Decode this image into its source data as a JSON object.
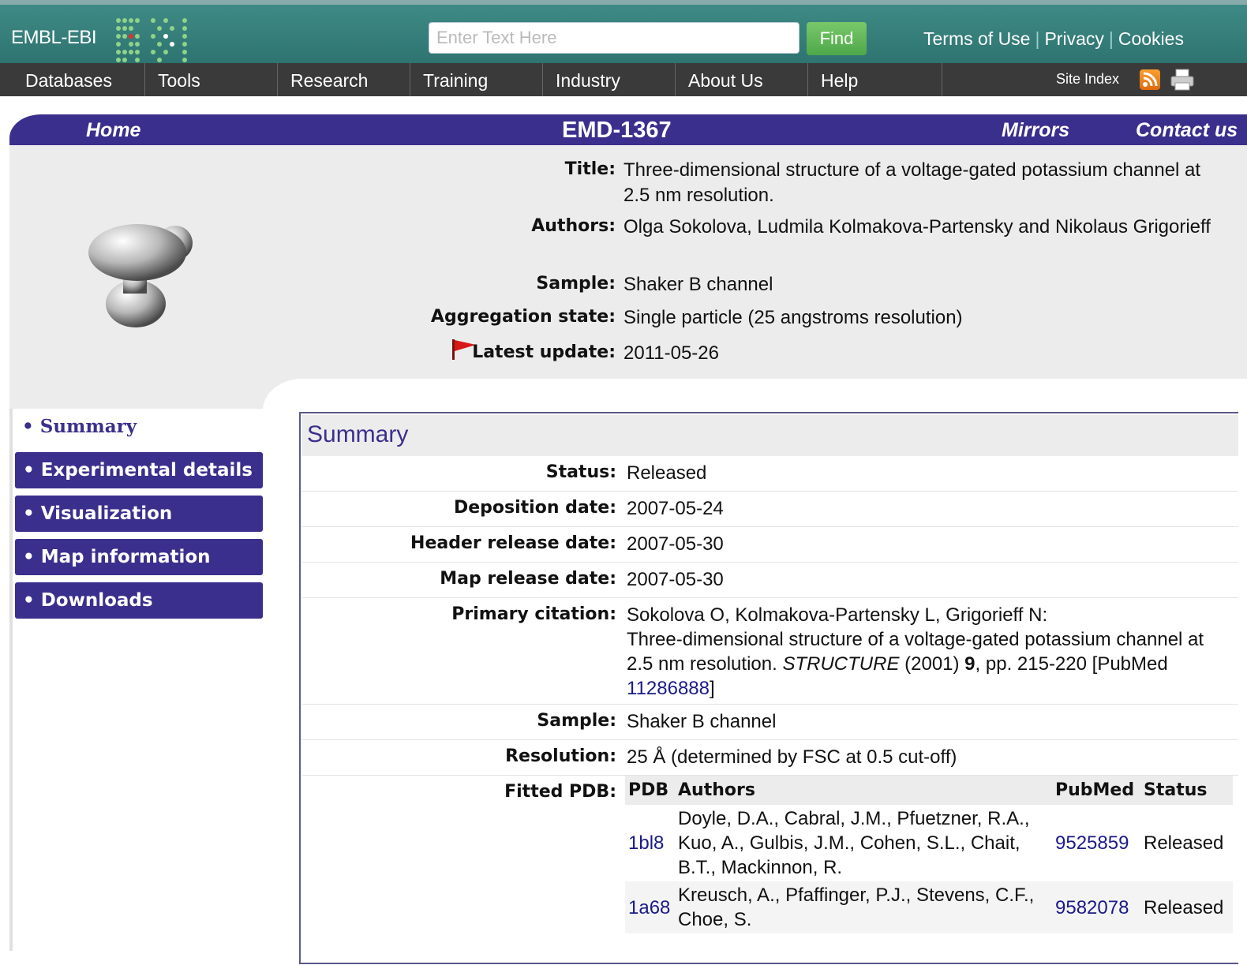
{
  "brand": {
    "logo_text": "EMBL-EBI"
  },
  "search": {
    "placeholder": "Enter Text Here",
    "button_label": "Find"
  },
  "util_links": [
    "Terms of Use",
    "Privacy",
    "Cookies"
  ],
  "nav": {
    "items": [
      "Databases",
      "Tools",
      "Research",
      "Training",
      "Industry",
      "About Us",
      "Help"
    ],
    "site_index": "Site Index",
    "rss_icon": "rss-icon",
    "print_icon": "printer-icon"
  },
  "header_bar": {
    "home": "Home",
    "entry_id": "EMD-1367",
    "mirrors": "Mirrors",
    "contact": "Contact us"
  },
  "entry": {
    "title_label": "Title:",
    "title": "Three-dimensional structure of a voltage-gated potassium channel at 2.5 nm resolution.",
    "authors_label": "Authors:",
    "authors": "Olga Sokolova, Ludmila Kolmakova-Partensky and Nikolaus Grigorieff",
    "sample_label": "Sample:",
    "sample": "Shaker B channel",
    "aggregation_label": "Aggregation state:",
    "aggregation": "Single particle (25 angstroms resolution)",
    "latest_update_label": "Latest update:",
    "latest_update": "2011-05-26"
  },
  "side_menu": {
    "active": "• Summary",
    "items": [
      "• Experimental details",
      "• Visualization",
      "• Map information",
      "• Downloads"
    ]
  },
  "summary": {
    "heading": "Summary",
    "status_label": "Status:",
    "status": "Released",
    "deposition_label": "Deposition date:",
    "deposition": "2007-05-24",
    "header_release_label": "Header release date:",
    "header_release": "2007-05-30",
    "map_release_label": "Map release date:",
    "map_release": "2007-05-30",
    "citation_label": "Primary citation:",
    "citation": {
      "authors": "Sokolova O, Kolmakova-Partensky L, Grigorieff N:",
      "title": "Three-dimensional structure of a voltage-gated potassium channel at 2.5 nm resolution.",
      "journal": "STRUCTURE",
      "year": "(2001)",
      "volume": "9",
      "pages": ", pp. 215-220 [PubMed ",
      "pubmed": "11286888",
      "close": "]"
    },
    "sample_label": "Sample:",
    "sample": "Shaker B channel",
    "resolution_label": "Resolution:",
    "resolution": "25 Å (determined by FSC at 0.5 cut-off)",
    "fitted_label": "Fitted PDB:",
    "fitted_headers": [
      "PDB",
      "Authors",
      "PubMed",
      "Status"
    ],
    "fitted_rows": [
      {
        "pdb": "1bl8",
        "authors": "Doyle, D.A., Cabral, J.M., Pfuetzner, R.A., Kuo, A., Gulbis, J.M., Cohen, S.L., Chait, B.T., Mackinnon, R.",
        "pubmed": "9525859",
        "status": "Released"
      },
      {
        "pdb": "1a68",
        "authors": "Kreusch, A., Pfaffinger, P.J., Stevens, C.F., Choe, S.",
        "pubmed": "9582078",
        "status": "Released"
      }
    ]
  },
  "colors": {
    "teal": "#2e7470",
    "nav": "#3a3a3a",
    "purple": "#3b2f8d",
    "find_green": "#4ea84a"
  }
}
